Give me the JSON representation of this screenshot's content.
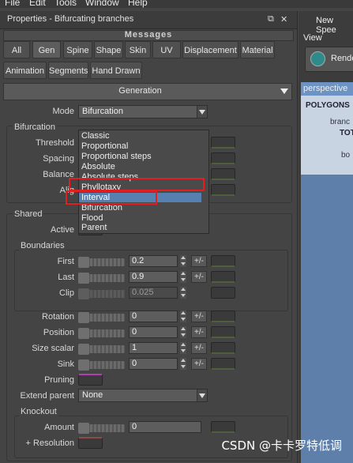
{
  "menubar": {
    "items": [
      "File",
      "Edit",
      "Tools",
      "Window",
      "Help"
    ]
  },
  "panel": {
    "title": "Properties - Bifurcating branches",
    "title_icons": [
      "dock-icon",
      "close-icon"
    ],
    "messages_label": "Messages",
    "tabs_row1": [
      "All",
      "Gen",
      "Spine",
      "Shape",
      "Skin",
      "UV",
      "Displacement",
      "Material"
    ],
    "tabs_row2": [
      "Animation",
      "Segments",
      "Hand Drawn"
    ],
    "selected_tab": "Gen",
    "section_title": "Generation"
  },
  "generation": {
    "mode_label": "Mode",
    "mode_value": "Bifurcation",
    "bifurcation_group": "Bifurcation",
    "threshold_label": "Threshold",
    "spacing_label": "Spacing",
    "balance_label": "Balance",
    "align_label": "Alig"
  },
  "mode_dropdown": {
    "options": [
      "Classic",
      "Proportional",
      "Proportional steps",
      "Absolute",
      "Absolute steps",
      "Phyllotaxy",
      "Interval",
      "Bifurcation",
      "Flood",
      "Parent"
    ],
    "highlighted": "Interval"
  },
  "shared": {
    "group_label": "Shared",
    "active_label": "Active",
    "boundaries_label": "Boundaries",
    "first_label": "First",
    "first_value": "0.2",
    "last_label": "Last",
    "last_value": "0.9",
    "clip_label": "Clip",
    "clip_value": "0.025",
    "rotation_label": "Rotation",
    "rotation_value": "0",
    "position_label": "Position",
    "position_value": "0",
    "size_scalar_label": "Size scalar",
    "size_scalar_value": "1",
    "sink_label": "Sink",
    "sink_value": "0",
    "pruning_label": "Pruning",
    "extend_parent_label": "Extend parent",
    "extend_parent_value": "None",
    "knockout_label": "Knockout",
    "amount_label": "Amount",
    "amount_value": "0",
    "resolution_label": "+ Resolution",
    "plusminus": "+/-"
  },
  "viewport": {
    "tab_label": "New Spee",
    "view_label": "View",
    "render_label": "Rende",
    "perspective_label": "perspective",
    "hud_lines": [
      "POLYGONS",
      "branc",
      "TOT",
      "bo"
    ]
  },
  "watermark": "CSDN @卡卡罗特低调",
  "colors": {
    "highlight": "#5680b0",
    "annotation": "#e02020",
    "viewport_blue": "#5d7fa9"
  }
}
